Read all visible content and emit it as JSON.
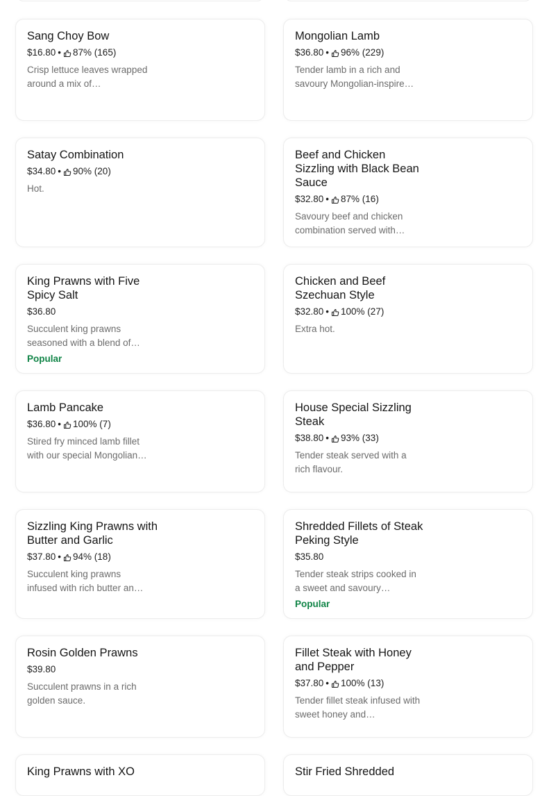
{
  "colors": {
    "popular": "#0e8345",
    "muted_text": "#6b6b6b",
    "card_border": "#ececec"
  },
  "icons": {
    "rating": "thumbs-up-icon"
  },
  "items": [
    {
      "name": "Sang Choy Bow",
      "price": "$16.80",
      "sep": "•",
      "rating": "87% (165)",
      "desc": "Crisp lettuce leaves wrapped around a mix of…",
      "popular": ""
    },
    {
      "name": "Mongolian Lamb",
      "price": "$36.80",
      "sep": "•",
      "rating": "96% (229)",
      "desc": "Tender lamb in a rich and savoury Mongolian-inspire…",
      "popular": ""
    },
    {
      "name": "Satay Combination",
      "price": "$34.80",
      "sep": "•",
      "rating": "90% (20)",
      "desc": "Hot.",
      "popular": ""
    },
    {
      "name": "Beef and Chicken Sizzling with Black Bean Sauce",
      "price": "$32.80",
      "sep": "•",
      "rating": "87% (16)",
      "desc": "Savoury beef and chicken combination served with…",
      "popular": ""
    },
    {
      "name": "King Prawns with Five Spicy Salt",
      "price": "$36.80",
      "sep": "",
      "rating": "",
      "desc": "Succulent king prawns seasoned with a blend of…",
      "popular": "Popular"
    },
    {
      "name": "Chicken and Beef Szechuan Style",
      "price": "$32.80",
      "sep": "•",
      "rating": "100% (27)",
      "desc": "Extra hot.",
      "popular": ""
    },
    {
      "name": "Lamb Pancake",
      "price": "$36.80",
      "sep": "•",
      "rating": "100% (7)",
      "desc": "Stired fry minced lamb fillet with our special Mongolian…",
      "popular": ""
    },
    {
      "name": "House Special Sizzling Steak",
      "price": "$38.80",
      "sep": "•",
      "rating": "93% (33)",
      "desc": "Tender steak served with a rich flavour.",
      "popular": ""
    },
    {
      "name": "Sizzling King Prawns with Butter and Garlic",
      "price": "$37.80",
      "sep": "•",
      "rating": "94% (18)",
      "desc": "Succulent king prawns infused with rich butter an…",
      "popular": ""
    },
    {
      "name": "Shredded Fillets of Steak Peking Style",
      "price": "$35.80",
      "sep": "",
      "rating": "",
      "desc": "Tender steak strips cooked in a sweet and savoury…",
      "popular": "Popular"
    },
    {
      "name": "Rosin Golden Prawns",
      "price": "$39.80",
      "sep": "",
      "rating": "",
      "desc": "Succulent prawns in a rich golden sauce.",
      "popular": ""
    },
    {
      "name": "Fillet Steak with Honey and Pepper",
      "price": "$37.80",
      "sep": "•",
      "rating": "100% (13)",
      "desc": "Tender fillet steak infused with sweet honey and…",
      "popular": ""
    },
    {
      "name": "King Prawns with XO",
      "price": "",
      "sep": "",
      "rating": "",
      "desc": "",
      "popular": ""
    },
    {
      "name": "Stir Fried Shredded",
      "price": "",
      "sep": "",
      "rating": "",
      "desc": "",
      "popular": ""
    }
  ]
}
